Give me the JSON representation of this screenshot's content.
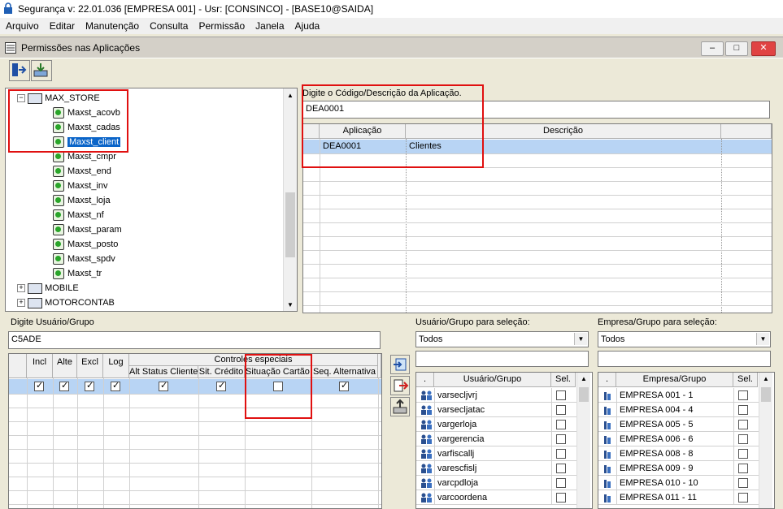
{
  "app": {
    "title": "Segurança  v: 22.01.036  [EMPRESA 001] - Usr: [CONSINCO] - [BASE10@SAIDA]"
  },
  "menu": [
    "Arquivo",
    "Editar",
    "Manutenção",
    "Consulta",
    "Permissão",
    "Janela",
    "Ajuda"
  ],
  "window": {
    "title": "Permissões nas Aplicações"
  },
  "tree": {
    "root": "MAX_STORE",
    "children": [
      "Maxst_acovb",
      "Maxst_cadas",
      "Maxst_client",
      "Maxst_cmpr",
      "Maxst_end",
      "Maxst_inv",
      "Maxst_loja",
      "Maxst_nf",
      "Maxst_param",
      "Maxst_posto",
      "Maxst_spdv",
      "Maxst_tr"
    ],
    "selected_index": 2,
    "siblings": [
      "MOBILE",
      "MOTORCONTAB"
    ]
  },
  "app_search": {
    "label": "Digite o Código/Descrição da Aplicação.",
    "value": "DEA0001",
    "columns": [
      "Aplicação",
      "Descrição"
    ],
    "rows": [
      {
        "app": "DEA0001",
        "desc": "Clientes"
      }
    ]
  },
  "user_search": {
    "label": "Digite Usuário/Grupo",
    "value": "C5ADE",
    "columns": [
      "Incl",
      "Alte",
      "Excl",
      "Log"
    ],
    "group_header": "Controles especiais",
    "special_columns": [
      "Alt Status Cliente",
      "Sit. Crédito",
      "Situação Cartão",
      "Seq. Alternativa"
    ],
    "row": {
      "incl": true,
      "alte": true,
      "excl": true,
      "log": true,
      "alt_status": true,
      "sit_credito": true,
      "situacao_cartao": false,
      "seq_alt": true
    }
  },
  "user_group_select": {
    "label": "Usuário/Grupo para seleção:",
    "combo_value": "Todos",
    "columns": [
      ".",
      "Usuário/Grupo",
      "Sel."
    ],
    "rows": [
      "varsecljvrj",
      "varsecljatac",
      "vargerloja",
      "vargerencia",
      "varfiscallj",
      "varescfislj",
      "varcpdloja",
      "varcoordena"
    ]
  },
  "company_group_select": {
    "label": "Empresa/Grupo para seleção:",
    "combo_value": "Todos",
    "columns": [
      ".",
      "Empresa/Grupo",
      "Sel."
    ],
    "rows": [
      "EMPRESA 001 - 1",
      "EMPRESA 004 - 4",
      "EMPRESA 005 - 5",
      "EMPRESA 006 - 6",
      "EMPRESA 008 - 8",
      "EMPRESA 009 - 9",
      "EMPRESA 010 - 10",
      "EMPRESA 011 - 11"
    ]
  },
  "colors": {
    "selection": "#0a64c8",
    "row_highlight": "#b8d4f4",
    "annotation": "#e01010"
  }
}
